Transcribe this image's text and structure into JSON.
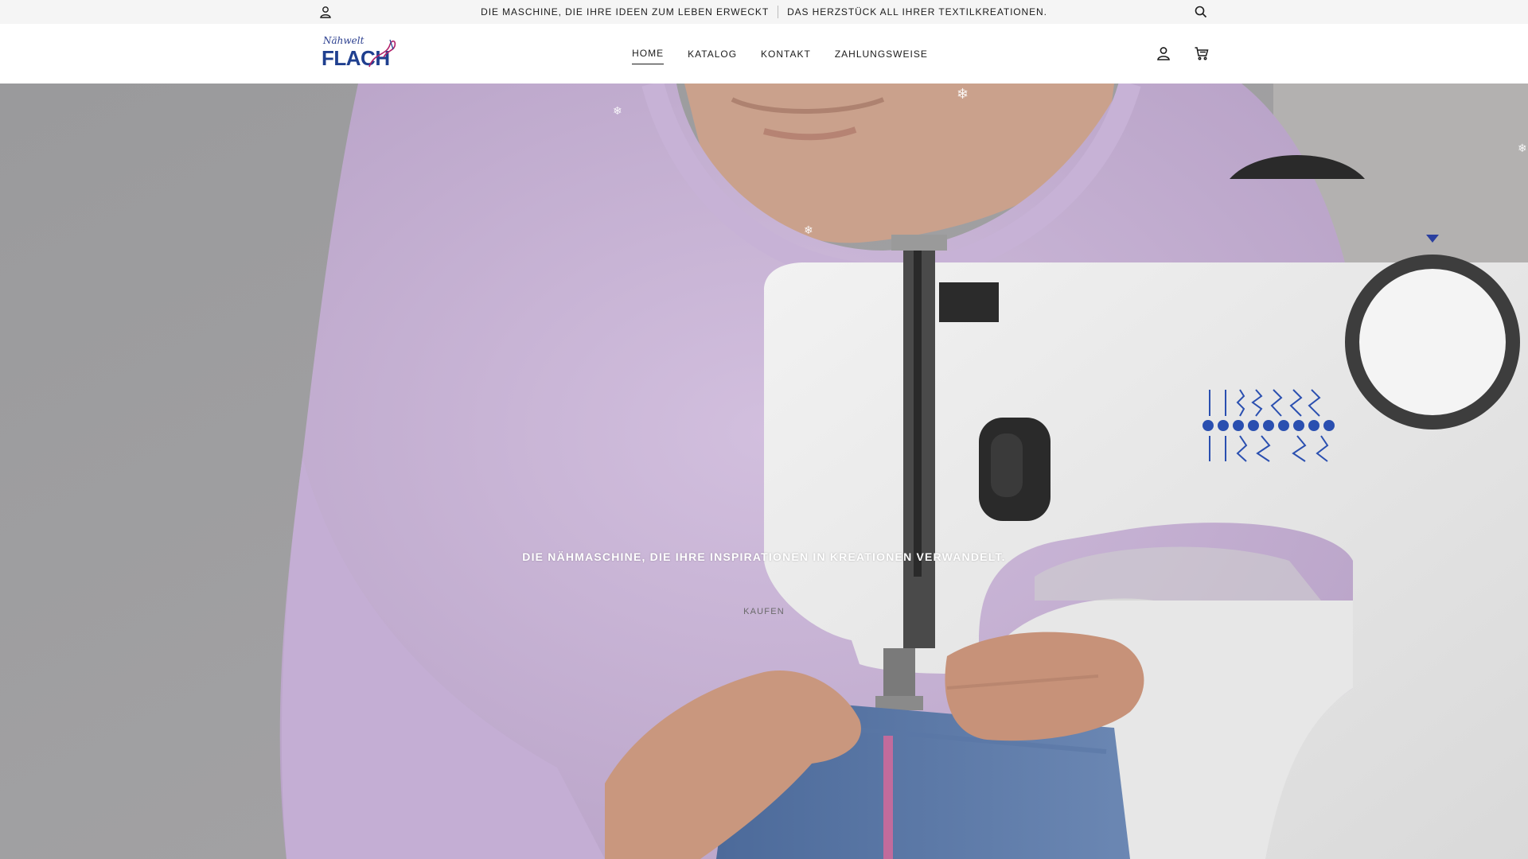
{
  "announcement": {
    "message_1": "DIE MASCHINE, DIE IHRE IDEEN ZUM LEBEN ERWECKT",
    "message_2": "DAS HERZSTÜCK ALL IHRER TEXTILKREATIONEN."
  },
  "logo": {
    "script": "Nähwelt",
    "word": "FLACH"
  },
  "nav": {
    "items": [
      {
        "label": "HOME",
        "active": true
      },
      {
        "label": "KATALOG",
        "active": false
      },
      {
        "label": "KONTAKT",
        "active": false
      },
      {
        "label": "ZAHLUNGSWEISE",
        "active": false
      }
    ]
  },
  "icons": {
    "announce_account": "user-icon",
    "announce_search": "search-icon",
    "header_account": "user-icon",
    "header_cart": "cart-icon",
    "decoration": "snowflake-icon"
  },
  "hero": {
    "heading": "DIE NÄHMASCHINE, DIE IHRE INSPIRATIONEN IN KREATIONEN VERWANDELT.",
    "button_label": "KAUFEN"
  },
  "colors": {
    "brand_blue": "#1f3f8f",
    "brand_magenta": "#b2226b",
    "announce_bg": "#f5f5f5"
  }
}
